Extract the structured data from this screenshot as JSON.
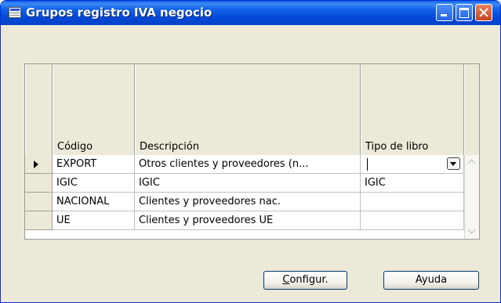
{
  "window": {
    "title": "Grupos registro IVA negocio"
  },
  "table": {
    "columns": [
      "Código",
      "Descripción",
      "Tipo de libro"
    ],
    "rows": [
      {
        "codigo": "EXPORT",
        "descripcion": "Otros clientes y proveedores (n...",
        "tipo": ""
      },
      {
        "codigo": "IGIC",
        "descripcion": "IGIC",
        "tipo": "IGIC"
      },
      {
        "codigo": "NACIONAL",
        "descripcion": "Clientes y proveedores nac.",
        "tipo": ""
      },
      {
        "codigo": "UE",
        "descripcion": "Clientes y proveedores UE",
        "tipo": ""
      }
    ]
  },
  "buttons": {
    "configur_mnemonic": "C",
    "configur_rest": "onfigur.",
    "ayuda": "Ayuda"
  },
  "colors": {
    "titlebar": "#0548d8",
    "window_bg": "#ece9d8",
    "close_button": "#c9441f"
  },
  "icons": [
    "table-icon",
    "minimize-icon",
    "maximize-icon",
    "close-icon",
    "row-pointer-icon",
    "dropdown-arrow-icon",
    "scroll-up-icon",
    "scroll-down-icon"
  ]
}
